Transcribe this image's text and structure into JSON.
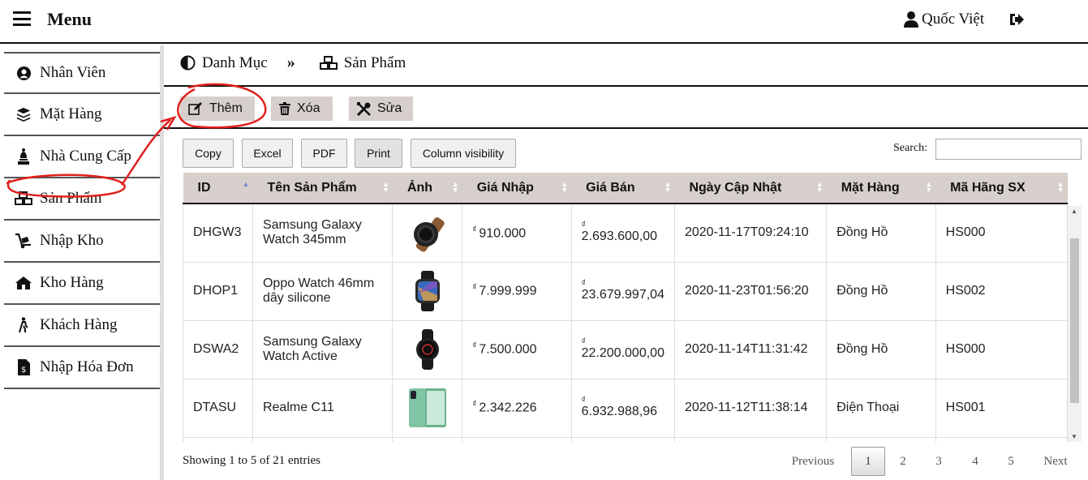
{
  "header": {
    "menu_title": "Menu",
    "user_name": "Quốc Việt"
  },
  "sidebar": {
    "items": [
      {
        "label": "Nhân Viên",
        "icon": "user-circle-icon"
      },
      {
        "label": "Mặt Hàng",
        "icon": "layers-icon"
      },
      {
        "label": "Nhà Cung Cấp",
        "icon": "chess-bishop-icon"
      },
      {
        "label": "Sản Phẩm",
        "icon": "cubes-icon"
      },
      {
        "label": "Nhập Kho",
        "icon": "dolly-icon"
      },
      {
        "label": "Kho Hàng",
        "icon": "home-icon"
      },
      {
        "label": "Khách Hàng",
        "icon": "walking-person-icon"
      },
      {
        "label": "Nhập Hóa Đơn",
        "icon": "invoice-icon"
      }
    ]
  },
  "breadcrumb": {
    "parent": "Danh Mục",
    "separator": "»",
    "current": "Sản Phẩm"
  },
  "actions": {
    "add": "Thêm",
    "delete": "Xóa",
    "edit": "Sửa"
  },
  "table_tools": {
    "copy": "Copy",
    "excel": "Excel",
    "pdf": "PDF",
    "print": "Print",
    "column_visibility": "Column visibility",
    "search_label": "Search:",
    "search_value": ""
  },
  "table": {
    "columns": [
      "ID",
      "Tên Sản Phẩm",
      "Ảnh",
      "Giá Nhập",
      "Giá Bán",
      "Ngày Cập Nhật",
      "Mặt Hàng",
      "Mã Hãng SX"
    ],
    "currency_symbol": "₫",
    "rows": [
      {
        "id": "DHGW3",
        "name": "Samsung Galaxy Watch 345mm",
        "image": "watch-brown-strap",
        "cost": "910.000",
        "price": "2.693.600,00",
        "updated": "2020-11-17T09:24:10",
        "category": "Đồng Hồ",
        "maker": "HS000"
      },
      {
        "id": "DHOP1",
        "name": "Oppo Watch 46mm dây silicone",
        "image": "watch-square-black",
        "cost": "7.999.999",
        "price": "23.679.997,04",
        "updated": "2020-11-23T01:56:20",
        "category": "Đồng Hồ",
        "maker": "HS002"
      },
      {
        "id": "DSWA2",
        "name": "Samsung Galaxy Watch Active",
        "image": "watch-round-black",
        "cost": "7.500.000",
        "price": "22.200.000,00",
        "updated": "2020-11-14T11:31:42",
        "category": "Đồng Hồ",
        "maker": "HS000"
      },
      {
        "id": "DTASU",
        "name": "Realme C11",
        "image": "phone-green",
        "cost": "2.342.226",
        "price": "6.932.988,96",
        "updated": "2020-11-12T11:38:14",
        "category": "Điện Thoại",
        "maker": "HS001"
      }
    ]
  },
  "footer": {
    "info": "Showing 1 to 5 of 21 entries",
    "previous": "Previous",
    "pages": [
      "1",
      "2",
      "3",
      "4",
      "5"
    ],
    "current_page": "1",
    "next": "Next"
  },
  "colors": {
    "header_bg": "#d6cfcb",
    "annotation": "#e0201c"
  }
}
